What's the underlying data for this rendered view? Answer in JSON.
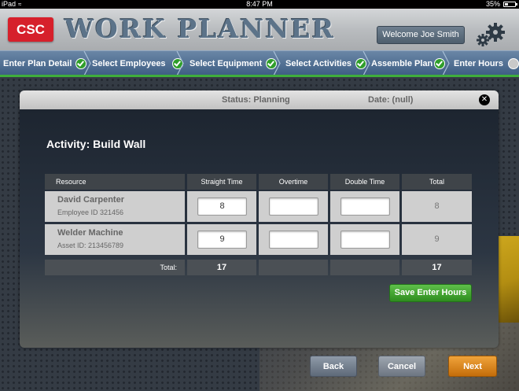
{
  "status_bar": {
    "carrier": "iPad",
    "time": "8:47 PM",
    "battery": "35%"
  },
  "header": {
    "logo": "CSC",
    "app_title": "WORK PLANNER",
    "welcome": "Welcome Joe Smith",
    "settings_icon": "gears-icon"
  },
  "steps": [
    {
      "label": "Enter Plan Detail",
      "state": "complete"
    },
    {
      "label": "Select Employees",
      "state": "complete"
    },
    {
      "label": "Select Equipment",
      "state": "complete"
    },
    {
      "label": "Select Activities",
      "state": "complete"
    },
    {
      "label": "Assemble Plan",
      "state": "complete"
    },
    {
      "label": "Enter Hours",
      "state": "current"
    }
  ],
  "panel": {
    "status": "Status: Planning",
    "date": "Date: (null)",
    "close_icon": "close-icon",
    "activity_title": "Activity: Build Wall"
  },
  "table": {
    "headers": [
      "Resource",
      "Straight Time",
      "Overtime",
      "Double Time",
      "Total"
    ],
    "rows": [
      {
        "name": "David Carpenter",
        "id": "Employee ID 321456",
        "straight": "8",
        "overtime": "",
        "double": "",
        "total": "8"
      },
      {
        "name": "Welder Machine",
        "id": "Asset ID: 213456789",
        "straight": "9",
        "overtime": "",
        "double": "",
        "total": "9"
      }
    ],
    "totals": {
      "label": "Total:",
      "straight": "17",
      "overtime": "",
      "double": "",
      "total": "17"
    }
  },
  "buttons": {
    "save": "Save Enter Hours",
    "back": "Back",
    "cancel": "Cancel",
    "next": "Next"
  },
  "colors": {
    "accent_green": "#3fae3c",
    "logo_red": "#d6202b",
    "step_bar_blue": "#4d6c8f",
    "next_orange": "#e08a1e"
  }
}
